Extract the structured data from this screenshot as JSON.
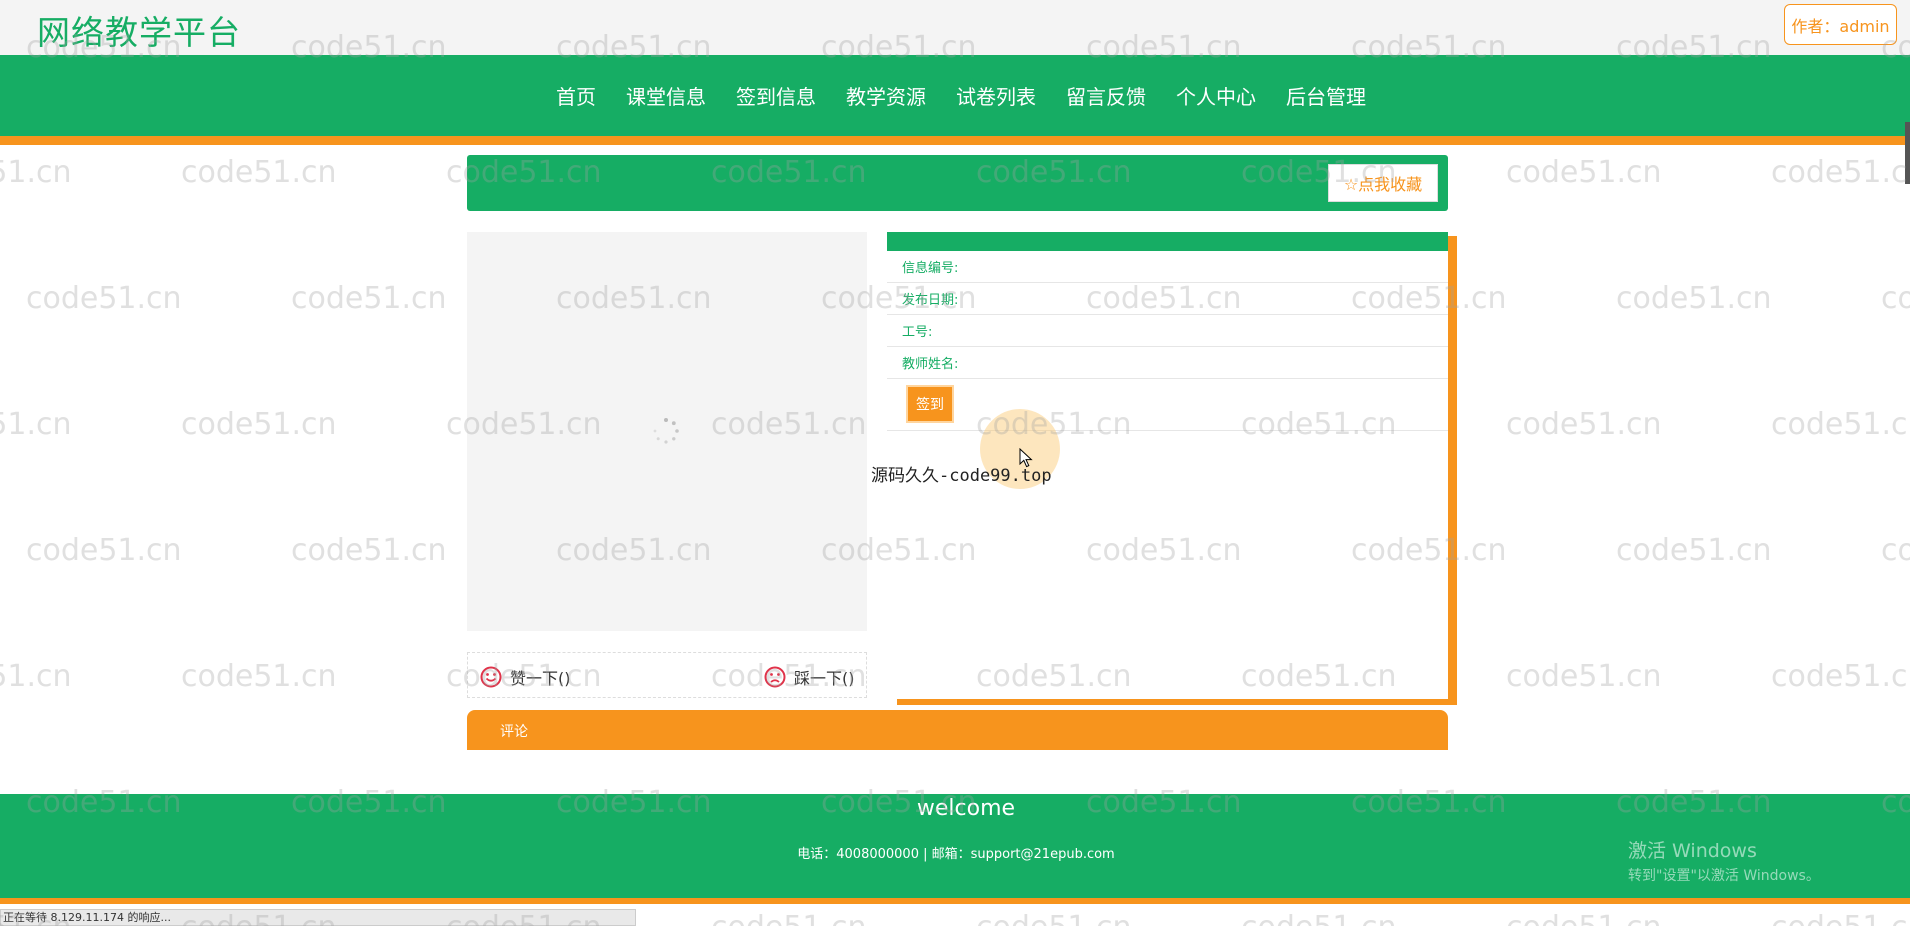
{
  "header": {
    "site_title": "网络教学平台",
    "author_label": "作者：admin"
  },
  "nav": {
    "items": [
      "首页",
      "课堂信息",
      "签到信息",
      "教学资源",
      "试卷列表",
      "留言反馈",
      "个人中心",
      "后台管理"
    ]
  },
  "detail": {
    "favorite_label": "☆点我收藏",
    "fields": [
      "信息编号:",
      "发布日期:",
      "工号:",
      "教师姓名:"
    ],
    "signin_label": "签到",
    "like_label": "赞一下()",
    "dislike_label": "踩一下()",
    "overlay_text": "源码久久-code99.top"
  },
  "comment": {
    "label": "评论"
  },
  "footer": {
    "welcome": "welcome",
    "contact": "电话：4008000000 | 邮箱：support@21epub.com"
  },
  "windows_watermark": {
    "title": "激活 Windows",
    "subtitle": "转到\"设置\"以激活 Windows。"
  },
  "status_bar": {
    "text": "正在等待 8.129.11.174 的响应..."
  },
  "watermark_text": "code51.cn",
  "colors": {
    "green": "#16ad64",
    "orange": "#f7941d"
  }
}
